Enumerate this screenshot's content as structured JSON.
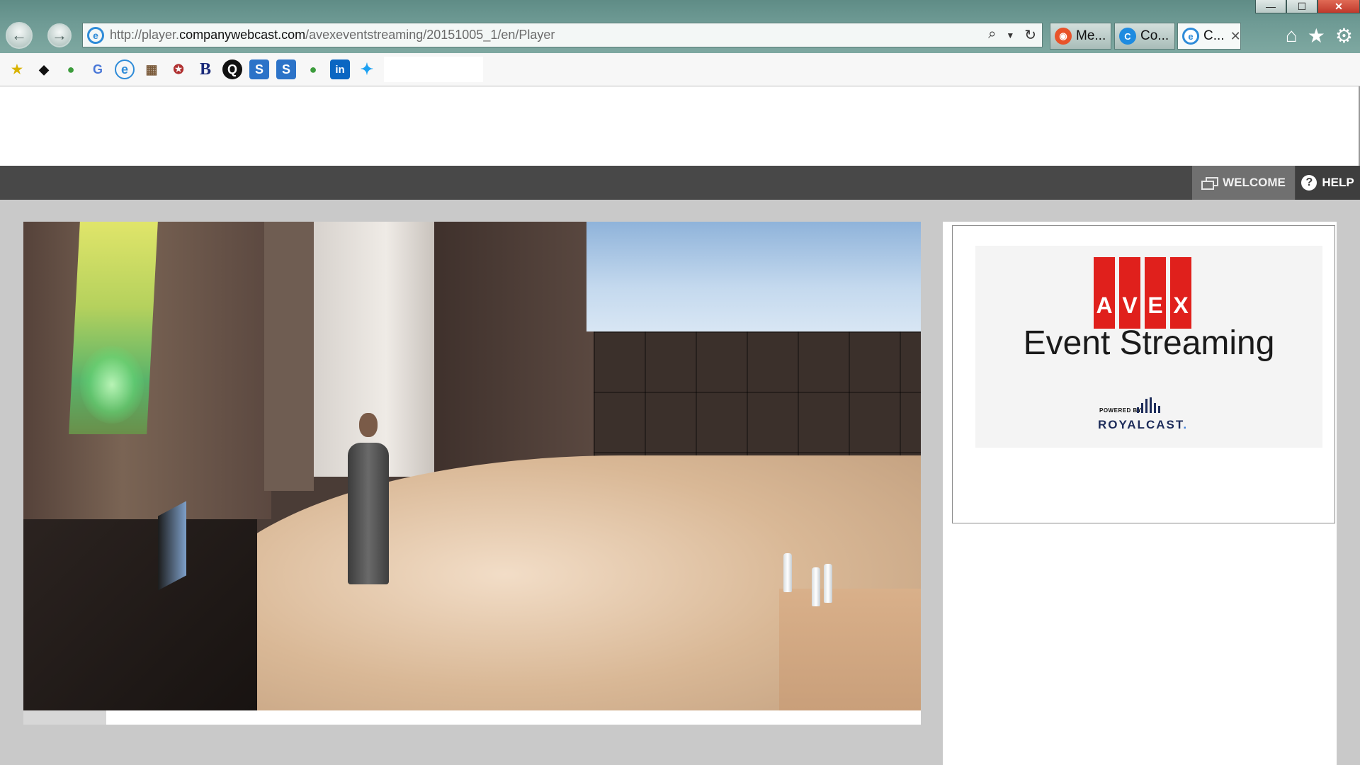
{
  "browser": {
    "url_prefix": "http://player.",
    "url_domain": "companywebcast.com",
    "url_path": "/avexeventstreaming/20151005_1/en/Player",
    "tabs": [
      {
        "label": "Me...",
        "icon": "rss-icon",
        "color": "#e8532a"
      },
      {
        "label": "Co...",
        "icon": "c-icon",
        "color": "#1e8be0"
      },
      {
        "label": "C...",
        "icon": "ie-icon",
        "color": "#2e8bd8"
      }
    ],
    "window_controls": {
      "minimize": "—",
      "maximize": "☐",
      "close": "✕"
    }
  },
  "favorites": [
    {
      "icon": "star-add-icon",
      "glyph": "★",
      "color": "#d9b300"
    },
    {
      "icon": "owl-icon",
      "glyph": "◆",
      "color": "#111111"
    },
    {
      "icon": "evernote-icon",
      "glyph": "●",
      "color": "#3c9c3c"
    },
    {
      "icon": "translate-icon",
      "glyph": "G",
      "color": "#4a78d8"
    },
    {
      "icon": "ie-page-icon",
      "glyph": "e",
      "color": "#2e8bd8"
    },
    {
      "icon": "image-icon",
      "glyph": "▦",
      "color": "#7a5a3a"
    },
    {
      "icon": "badge-icon",
      "glyph": "✪",
      "color": "#b03030"
    },
    {
      "icon": "b-icon",
      "glyph": "B",
      "color": "#1a2a7a"
    },
    {
      "icon": "q-icon",
      "glyph": "Q",
      "color": "#111111"
    },
    {
      "icon": "sharepoint-icon",
      "glyph": "S",
      "color": "#2c73c8"
    },
    {
      "icon": "sharepoint-icon-2",
      "glyph": "S",
      "color": "#2c73c8"
    },
    {
      "icon": "evernote-icon-2",
      "glyph": "●",
      "color": "#3c9c3c"
    },
    {
      "icon": "linkedin-icon",
      "glyph": "in",
      "color": "#0a66c2"
    },
    {
      "icon": "twitter-icon",
      "glyph": "🐦",
      "color": "#1da1f2"
    }
  ],
  "menu": {
    "welcome": "WELCOME",
    "help": "HELP"
  },
  "player": {
    "progress_fraction": 0.092
  },
  "logo": {
    "letters": [
      "A",
      "V",
      "E",
      "X"
    ],
    "tagline": "Event Streaming",
    "powered_by": "POWERED BY",
    "brand": "ROYALCAST",
    "brand_dot": ".",
    "accent_color": "#e0201c",
    "brand_color": "#1d2c5a"
  }
}
